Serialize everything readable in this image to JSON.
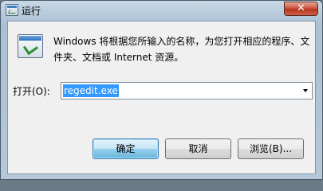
{
  "window": {
    "title": "运行",
    "close_glyph": "✕"
  },
  "content": {
    "description": "Windows 将根据您所输入的名称，为您打开相应的程序、文件夹、文档或 Internet 资源。",
    "icon": "run-icon"
  },
  "open_field": {
    "label": "打开(O):",
    "value": "regedit.exe"
  },
  "buttons": {
    "ok": "确定",
    "cancel": "取消",
    "browse": "浏览(B)..."
  },
  "colors": {
    "selection": "#3399ff",
    "close": "#c94a36"
  }
}
